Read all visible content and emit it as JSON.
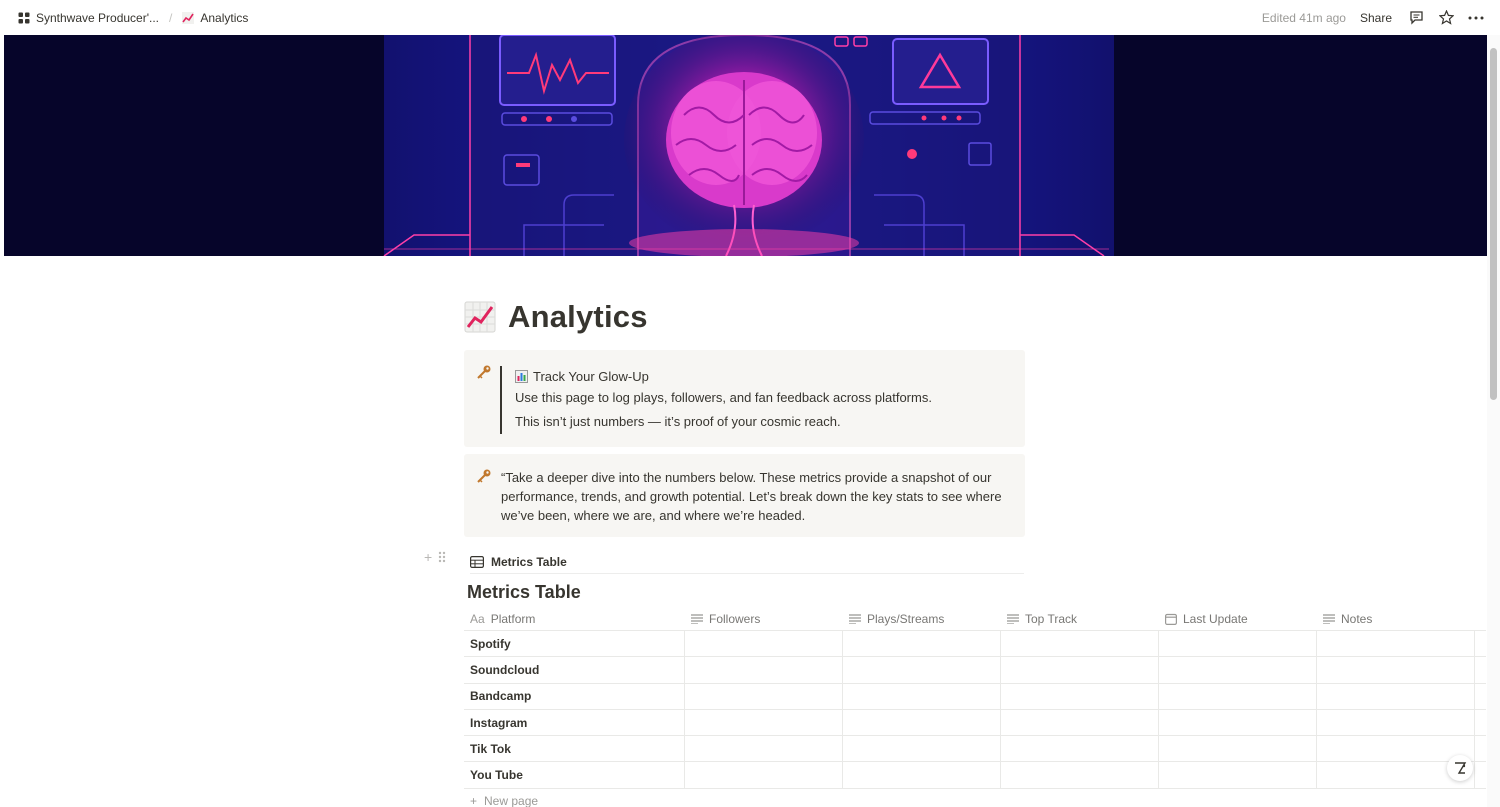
{
  "topbar": {
    "breadcrumbs": [
      {
        "icon": "dashboard-icon",
        "label": "Synthwave Producer'..."
      },
      {
        "icon": "chart-increasing-icon",
        "label": "Analytics"
      }
    ],
    "edited": "Edited 41m ago",
    "share_label": "Share"
  },
  "page": {
    "title": "Analytics",
    "title_icon": "chart-increasing-icon"
  },
  "callout1": {
    "icon": "key-icon",
    "heading_icon": "bar-chart-icon",
    "heading": "Track Your Glow-Up",
    "lines": [
      "Use this page to log plays, followers, and fan feedback across platforms.",
      "This isn’t just numbers — it’s proof of your cosmic reach."
    ]
  },
  "callout2": {
    "icon": "key-icon",
    "text": "“Take a deeper dive into the numbers below. These metrics provide a snapshot of our performance, trends, and growth potential. Let’s break down the key stats to see where we’ve been, where we are, and where we’re headed."
  },
  "linked_database": {
    "label": "Metrics Table",
    "icon": "table-icon"
  },
  "database": {
    "title": "Metrics Table",
    "columns": [
      {
        "icon": "Aa",
        "label": "Platform"
      },
      {
        "icon": "text-lines-icon",
        "label": "Followers"
      },
      {
        "icon": "text-lines-icon",
        "label": "Plays/Streams"
      },
      {
        "icon": "text-lines-icon",
        "label": "Top Track"
      },
      {
        "icon": "calendar-icon",
        "label": "Last Update"
      },
      {
        "icon": "text-lines-icon",
        "label": "Notes"
      }
    ],
    "rows": [
      {
        "platform": "Spotify"
      },
      {
        "platform": "Soundcloud"
      },
      {
        "platform": "Bandcamp"
      },
      {
        "platform": "Instagram"
      },
      {
        "platform": "Tik Tok"
      },
      {
        "platform": "You Tube"
      }
    ],
    "new_page_label": "New page"
  },
  "colors": {
    "accent_pink": "#ff2fa8",
    "cover_bg": "#07062a",
    "callout_bg": "#f7f6f3"
  }
}
